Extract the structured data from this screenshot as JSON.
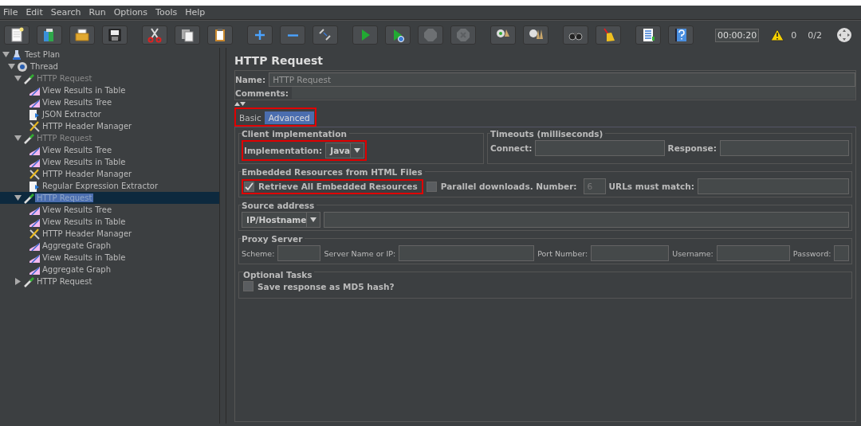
{
  "menu": [
    "File",
    "Edit",
    "Search",
    "Run",
    "Options",
    "Tools",
    "Help"
  ],
  "toolbar": [
    [
      {
        "kind": "new",
        "disabled": false
      },
      {
        "kind": "templates",
        "disabled": false
      },
      {
        "kind": "open",
        "disabled": false
      },
      {
        "kind": "save",
        "disabled": false
      }
    ],
    [
      {
        "kind": "cut",
        "disabled": false
      },
      {
        "kind": "copy",
        "disabled": false
      },
      {
        "kind": "paste",
        "disabled": false
      }
    ],
    [
      {
        "kind": "expand",
        "disabled": false
      },
      {
        "kind": "collapse",
        "disabled": false
      },
      {
        "kind": "toggle",
        "disabled": false
      }
    ],
    [
      {
        "kind": "start",
        "disabled": false
      },
      {
        "kind": "start-no-timers",
        "disabled": false
      },
      {
        "kind": "stop",
        "disabled": true
      },
      {
        "kind": "shutdown",
        "disabled": true
      }
    ],
    [
      {
        "kind": "clear",
        "disabled": false
      },
      {
        "kind": "clear-all",
        "disabled": false
      }
    ],
    [
      {
        "kind": "search",
        "disabled": false
      },
      {
        "kind": "reset-search",
        "disabled": false
      }
    ],
    [
      {
        "kind": "function-helper",
        "disabled": false
      },
      {
        "kind": "help",
        "disabled": false
      }
    ]
  ],
  "status": {
    "timer": "00:00:20",
    "warnings": "0",
    "threads": "0/2"
  },
  "tree": [
    {
      "label": "Test Plan",
      "kind": "plan",
      "expanded": true,
      "selected": false,
      "disabled": false,
      "children": [
        {
          "label": "Thread",
          "kind": "thread",
          "expanded": true,
          "selected": false,
          "disabled": false,
          "children": [
            {
              "label": "HTTP Request",
              "kind": "sampler",
              "expanded": true,
              "selected": false,
              "disabled": true,
              "children": [
                {
                  "label": "View Results in Table",
                  "kind": "listener",
                  "selected": false,
                  "disabled": false
                },
                {
                  "label": "View Results Tree",
                  "kind": "listener",
                  "selected": false,
                  "disabled": false
                },
                {
                  "label": "JSON Extractor",
                  "kind": "extractor",
                  "selected": false,
                  "disabled": false
                },
                {
                  "label": "HTTP Header Manager",
                  "kind": "config",
                  "selected": false,
                  "disabled": false
                }
              ]
            },
            {
              "label": "HTTP Request",
              "kind": "sampler",
              "expanded": true,
              "selected": false,
              "disabled": true,
              "children": [
                {
                  "label": "View Results Tree",
                  "kind": "listener",
                  "selected": false,
                  "disabled": false
                },
                {
                  "label": "View Results in Table",
                  "kind": "listener",
                  "selected": false,
                  "disabled": false
                },
                {
                  "label": "HTTP Header Manager",
                  "kind": "config",
                  "selected": false,
                  "disabled": false
                },
                {
                  "label": "Regular Expression Extractor",
                  "kind": "extractor",
                  "selected": false,
                  "disabled": false
                }
              ]
            },
            {
              "label": "HTTP Request",
              "kind": "sampler",
              "expanded": true,
              "selected": true,
              "disabled": false,
              "children": [
                {
                  "label": "View Results Tree",
                  "kind": "listener",
                  "selected": false,
                  "disabled": false
                },
                {
                  "label": "View Results in Table",
                  "kind": "listener",
                  "selected": false,
                  "disabled": false
                },
                {
                  "label": "HTTP Header Manager",
                  "kind": "config",
                  "selected": false,
                  "disabled": false
                },
                {
                  "label": "Aggregate Graph",
                  "kind": "listener",
                  "selected": false,
                  "disabled": false
                },
                {
                  "label": "View Results in Table",
                  "kind": "listener",
                  "selected": false,
                  "disabled": false
                },
                {
                  "label": "Aggregate Graph",
                  "kind": "listener",
                  "selected": false,
                  "disabled": false
                }
              ]
            },
            {
              "label": "HTTP Request",
              "kind": "sampler",
              "expanded": false,
              "selected": false,
              "disabled": false
            }
          ]
        }
      ]
    }
  ],
  "panel": {
    "title": "HTTP Request",
    "name_label": "Name:",
    "name_value": "HTTP Request",
    "comments_label": "Comments:",
    "tabs": [
      {
        "label": "Basic",
        "selected": false
      },
      {
        "label": "Advanced",
        "selected": true
      }
    ],
    "tabs_highlighted": true,
    "client": {
      "legend": "Client implementation",
      "label": "Implementation:",
      "value": "Java",
      "highlighted": true
    },
    "timeouts": {
      "legend": "Timeouts (milliseconds)",
      "fields": [
        {
          "label": "Connect:"
        },
        {
          "label": "Response:"
        }
      ]
    },
    "embedded": {
      "legend": "Embedded Resources from HTML Files",
      "retrieve": {
        "label": "Retrieve All Embedded Resources",
        "checked": true,
        "highlighted": true
      },
      "parallel": {
        "label": "Parallel downloads. Number:",
        "checked": false
      },
      "number": "6",
      "urls_label": "URLs must match:"
    },
    "source": {
      "legend": "Source address",
      "type": "IP/Hostname"
    },
    "proxy": {
      "legend": "Proxy Server",
      "fields": [
        {
          "label": "Scheme:"
        },
        {
          "label": "Server Name or IP:"
        },
        {
          "label": "Port Number:"
        },
        {
          "label": "Username:"
        },
        {
          "label": "Password:"
        }
      ]
    },
    "optional": {
      "legend": "Optional Tasks",
      "md5": {
        "label": "Save response as MD5 hash?",
        "checked": false
      }
    }
  }
}
